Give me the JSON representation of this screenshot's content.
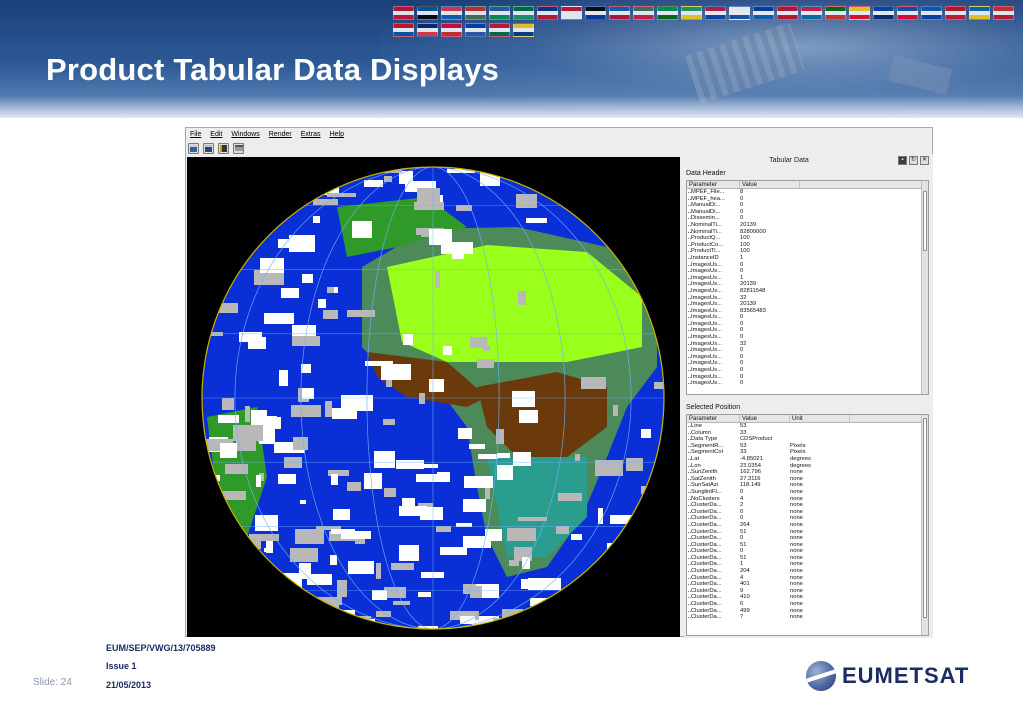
{
  "slide": {
    "title": "Product Tabular Data Displays",
    "slide_label": "Slide: 24",
    "doc_ref": "EUM/SEP/VWG/13/705889",
    "issue": "Issue 1",
    "date": "21/05/2013",
    "logo_text": "EUMETSAT"
  },
  "flags": [
    "#c8102e",
    "#0055a4",
    "#ef3340",
    "#d52b1e",
    "#2b57a5",
    "#006b3f",
    "#003580",
    "#d00c33",
    "#000000",
    "#0d5eaf",
    "#477050",
    "#009246",
    "#169b62",
    "#c8102e",
    "#ffffff",
    "#0033a0",
    "#bf0a30",
    "#dc143c",
    "#006600",
    "#f7d117",
    "#003da5",
    "#0b4ea2",
    "#005bac",
    "#c60b1e",
    "#006aa7",
    "#d52b1e",
    "#e30a17",
    "#012169",
    "#e4002b",
    "#0039a6",
    "#ce1126",
    "#fcd116"
  ],
  "app": {
    "menus": [
      "File",
      "Edit",
      "Windows",
      "Render",
      "Extras",
      "Help"
    ],
    "toolbar": [
      "save-icon",
      "save-all-icon",
      "save-as-icon",
      "print-icon"
    ],
    "panel_title": "Tabular Data",
    "data_header": {
      "label": "Data Header",
      "columns": [
        "Parameter",
        "Value"
      ],
      "rows": [
        [
          "MPEF_File...",
          "8"
        ],
        [
          "MPEF_hea...",
          "0"
        ],
        [
          "ManualDi...",
          "0"
        ],
        [
          "ManualDi...",
          "0"
        ],
        [
          "Dissemin...",
          "0"
        ],
        [
          "NominalTi...",
          "20139"
        ],
        [
          "NominalTi...",
          "82800000"
        ],
        [
          "ProductQ...",
          "100"
        ],
        [
          "ProductCo...",
          "100"
        ],
        [
          "ProductTi...",
          "100"
        ],
        [
          "InstanceID",
          "1"
        ],
        [
          "ImagesUs...",
          "0"
        ],
        [
          "ImagesUs...",
          "0"
        ],
        [
          "ImagesUs...",
          "1"
        ],
        [
          "ImagesUs...",
          "20139"
        ],
        [
          "ImagesUs...",
          "82811548"
        ],
        [
          "ImagesUs...",
          "32"
        ],
        [
          "ImagesUs...",
          "20139"
        ],
        [
          "ImagesUs...",
          "83565483"
        ],
        [
          "ImagesUs...",
          "0"
        ],
        [
          "ImagesUs...",
          "0"
        ],
        [
          "ImagesUs...",
          "0"
        ],
        [
          "ImagesUs...",
          "0"
        ],
        [
          "ImagesUs...",
          "32"
        ],
        [
          "ImagesUs...",
          "0"
        ],
        [
          "ImagesUs...",
          "0"
        ],
        [
          "ImagesUs...",
          "0"
        ],
        [
          "ImagesUs...",
          "0"
        ],
        [
          "ImagesUs...",
          "0"
        ],
        [
          "ImagesUs...",
          "0"
        ]
      ]
    },
    "selected_position": {
      "label": "Selected Position",
      "columns": [
        "Parameter",
        "Value",
        "Unit"
      ],
      "rows": [
        [
          "Line",
          "53",
          ""
        ],
        [
          "Column",
          "33",
          ""
        ],
        [
          "Data Type",
          "CDSProduct",
          ""
        ],
        [
          "SegmentR...",
          "53",
          "Pixels"
        ],
        [
          "SegmentCol",
          "33",
          "Pixels"
        ],
        [
          "Lat",
          "-4.85021",
          "degrees"
        ],
        [
          "Lon",
          "23.0354",
          "degrees"
        ],
        [
          "SunZenith",
          "162.796",
          "none"
        ],
        [
          "SatZenith",
          "27.3116",
          "none"
        ],
        [
          "SunSatAzi",
          "118.149",
          "none"
        ],
        [
          "SunglintFl...",
          "0",
          "none"
        ],
        [
          "NoClusters",
          "4",
          "none"
        ],
        [
          "ClusterDa...",
          "2",
          "none"
        ],
        [
          "ClusterDa...",
          "0",
          "none"
        ],
        [
          "ClusterDa...",
          "0",
          "none"
        ],
        [
          "ClusterDa...",
          "264",
          "none"
        ],
        [
          "ClusterDa...",
          "51",
          "none"
        ],
        [
          "ClusterDa...",
          "0",
          "none"
        ],
        [
          "ClusterDa...",
          "51",
          "none"
        ],
        [
          "ClusterDa...",
          "0",
          "none"
        ],
        [
          "ClusterDa...",
          "51",
          "none"
        ],
        [
          "ClusterDa...",
          "1",
          "none"
        ],
        [
          "ClusterDa...",
          "204",
          "none"
        ],
        [
          "ClusterDa...",
          "4",
          "none"
        ],
        [
          "ClusterDa...",
          "401",
          "none"
        ],
        [
          "ClusterDa...",
          "9",
          "none"
        ],
        [
          "ClusterDa...",
          "410",
          "none"
        ],
        [
          "ClusterDa...",
          "6",
          "none"
        ],
        [
          "ClusterDa...",
          "499",
          "none"
        ],
        [
          "ClusterDa...",
          "7",
          "none"
        ]
      ]
    }
  },
  "map_colors": {
    "ocean": "#0a2fd6",
    "cloud": "#ffffff",
    "haze": "#b8b8b8",
    "sahara": "#9aff1a",
    "sahel": "#4c8a5a",
    "forest": "#2f9a2a",
    "soil": "#6b3a0c",
    "teal": "#2a9d8f",
    "space": "#000000"
  }
}
